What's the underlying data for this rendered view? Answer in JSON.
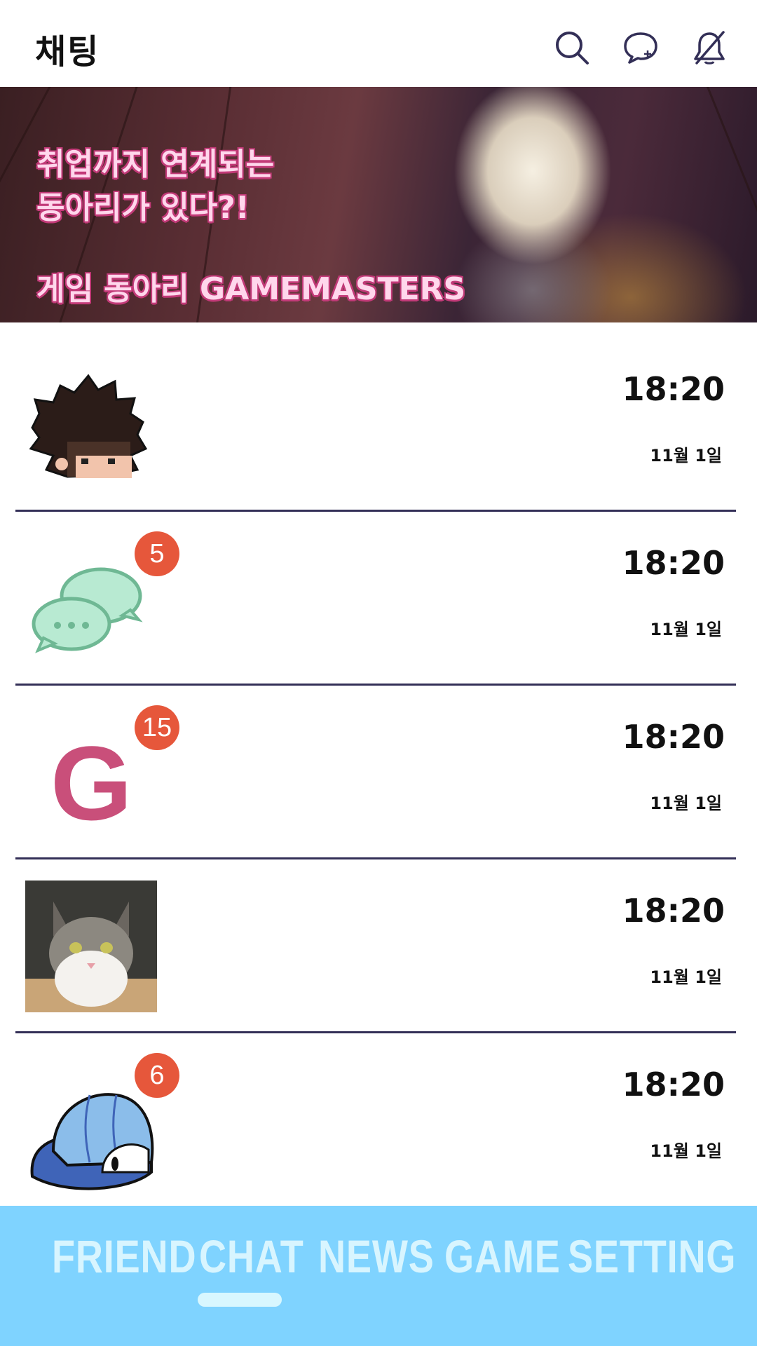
{
  "header": {
    "title": "채팅",
    "icons": [
      "search-icon",
      "new-chat-icon",
      "notifications-off-icon"
    ]
  },
  "banner": {
    "line1": "취업까지 연계되는",
    "line2": "동아리가 있다?!",
    "line3": "게임 동아리 GAMEMASTERS"
  },
  "chats": [
    {
      "avatar": "pixel-character-avatar",
      "time": "18:20",
      "date": "11월 1일",
      "badge": ""
    },
    {
      "avatar": "chat-bubbles-avatar",
      "time": "18:20",
      "date": "11월 1일",
      "badge": "5"
    },
    {
      "avatar": "letter-g-avatar",
      "avatar_letter": "G",
      "time": "18:20",
      "date": "11월 1일",
      "badge": "15"
    },
    {
      "avatar": "cat-photo-avatar",
      "time": "18:20",
      "date": "11월 1일",
      "badge": ""
    },
    {
      "avatar": "blue-cap-avatar",
      "time": "18:20",
      "date": "11월 1일",
      "badge": "6"
    }
  ],
  "nav": {
    "tabs": [
      "FRIEND",
      "CHAT",
      "NEWS",
      "GAME",
      "SETTING"
    ],
    "active": "CHAT"
  },
  "colors": {
    "nav_bg": "#7fd3ff",
    "badge": "#e6573b",
    "divider": "#332f57",
    "banner_text": "#ffd7ec",
    "letter_g": "#c94f7a"
  }
}
